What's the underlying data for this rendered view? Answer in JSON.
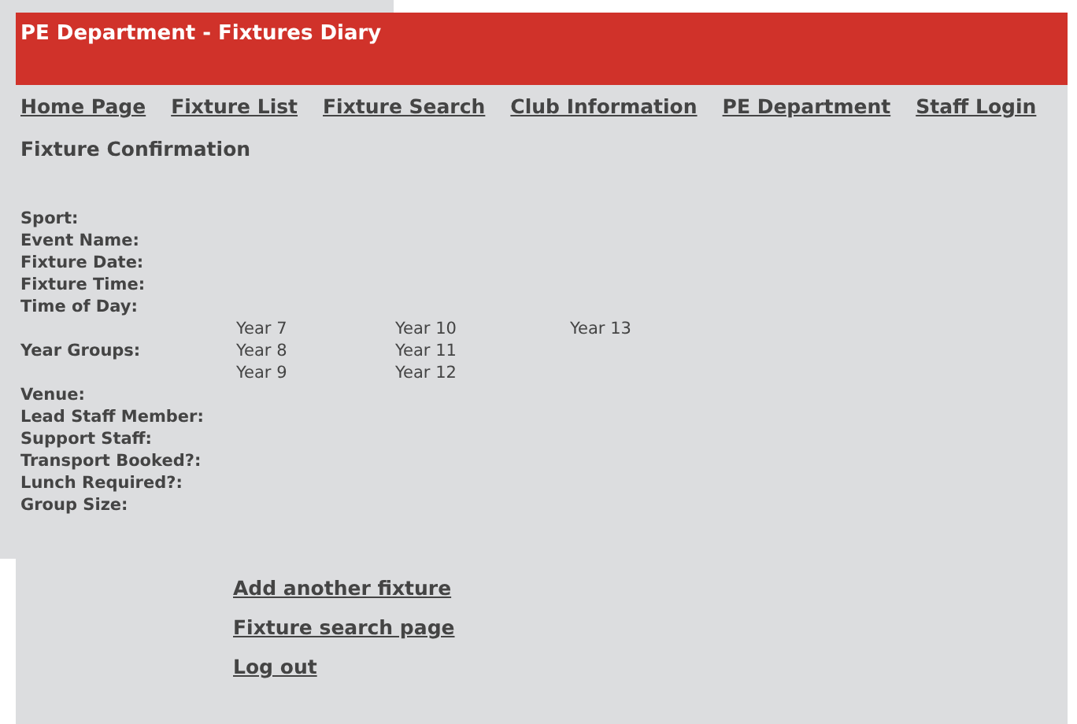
{
  "header": {
    "title": "PE Department - Fixtures Diary"
  },
  "nav": [
    "Home Page",
    "Fixture List",
    "Fixture Search",
    "Club Information",
    "PE Department",
    "Staff Login"
  ],
  "heading": "Fixture Confirmation",
  "fields": [
    {
      "kind": "text",
      "label": "Sport:"
    },
    {
      "kind": "text",
      "label": "Event Name:"
    },
    {
      "kind": "text",
      "label": "Fixture Date:"
    },
    {
      "kind": "text",
      "label": "Fixture Time:"
    },
    {
      "kind": "text",
      "label": "Time of Day:"
    },
    {
      "kind": "options",
      "label": "Year Groups:",
      "options": [
        "Year 7",
        "Year 8",
        "Year 9",
        "Year 10",
        "Year 11",
        "Year 12",
        "Year 13"
      ]
    },
    {
      "kind": "text",
      "label": "Venue:"
    },
    {
      "kind": "text",
      "label": "Lead Staff Member:"
    },
    {
      "kind": "text",
      "label": "Support Staff:"
    },
    {
      "kind": "text",
      "label": "Transport Booked?:"
    },
    {
      "kind": "text",
      "label": "Lunch Required?:"
    },
    {
      "kind": "text",
      "label": "Group Size:"
    }
  ],
  "links": [
    "Add another fixture",
    "Fixture search page",
    "Log out"
  ]
}
